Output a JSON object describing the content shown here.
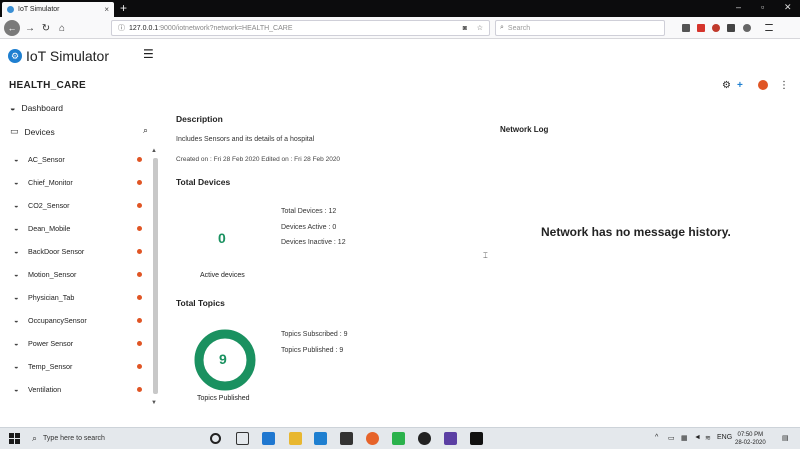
{
  "browser": {
    "tab_title": "IoT Simulator",
    "url_host": "127.0.0.1",
    "url_rest": ":9000/iotnetwork?network=HEALTH_CARE",
    "search_placeholder": "Search"
  },
  "app": {
    "logo_text": "IoT Simulator",
    "network_name": "HEALTH_CARE"
  },
  "sidebar": {
    "dashboard_label": "Dashboard",
    "devices_label": "Devices",
    "devices": [
      "AC_Sensor",
      "Chief_Monitor",
      "CO2_Sensor",
      "Dean_Mobile",
      "BackDoor Sensor",
      "Motion_Sensor",
      "Physician_Tab",
      "OccupancySensor",
      "Power Sensor",
      "Temp_Sensor",
      "Ventilation"
    ],
    "status_color": "#e05524"
  },
  "main": {
    "description_heading": "Description",
    "description_text": "Includes Sensors and its details of a hospital",
    "dates": "Created on : Fri 28 Feb 2020    Edited on : Fri 28 Feb 2020",
    "total_devices_heading": "Total Devices",
    "active_count": "0",
    "active_label": "Active devices",
    "stats": [
      "Total Devices : 12",
      "Devices Active : 0",
      "Devices Inactive : 12"
    ],
    "total_topics_heading": "Total Topics",
    "topics_count": "9",
    "topics_label": "Topics Published",
    "topic_stats": [
      "Topics Subscribed : 9",
      "Topics Published : 9"
    ],
    "topics_ratio": 1.0,
    "accent_color": "#1a9160"
  },
  "network_log": {
    "heading": "Network Log",
    "empty_message": "Network has no message history."
  },
  "taskbar": {
    "search_placeholder": "Type here to search",
    "language": "ENG",
    "time": "07:50 PM",
    "date": "28-02-2020"
  }
}
